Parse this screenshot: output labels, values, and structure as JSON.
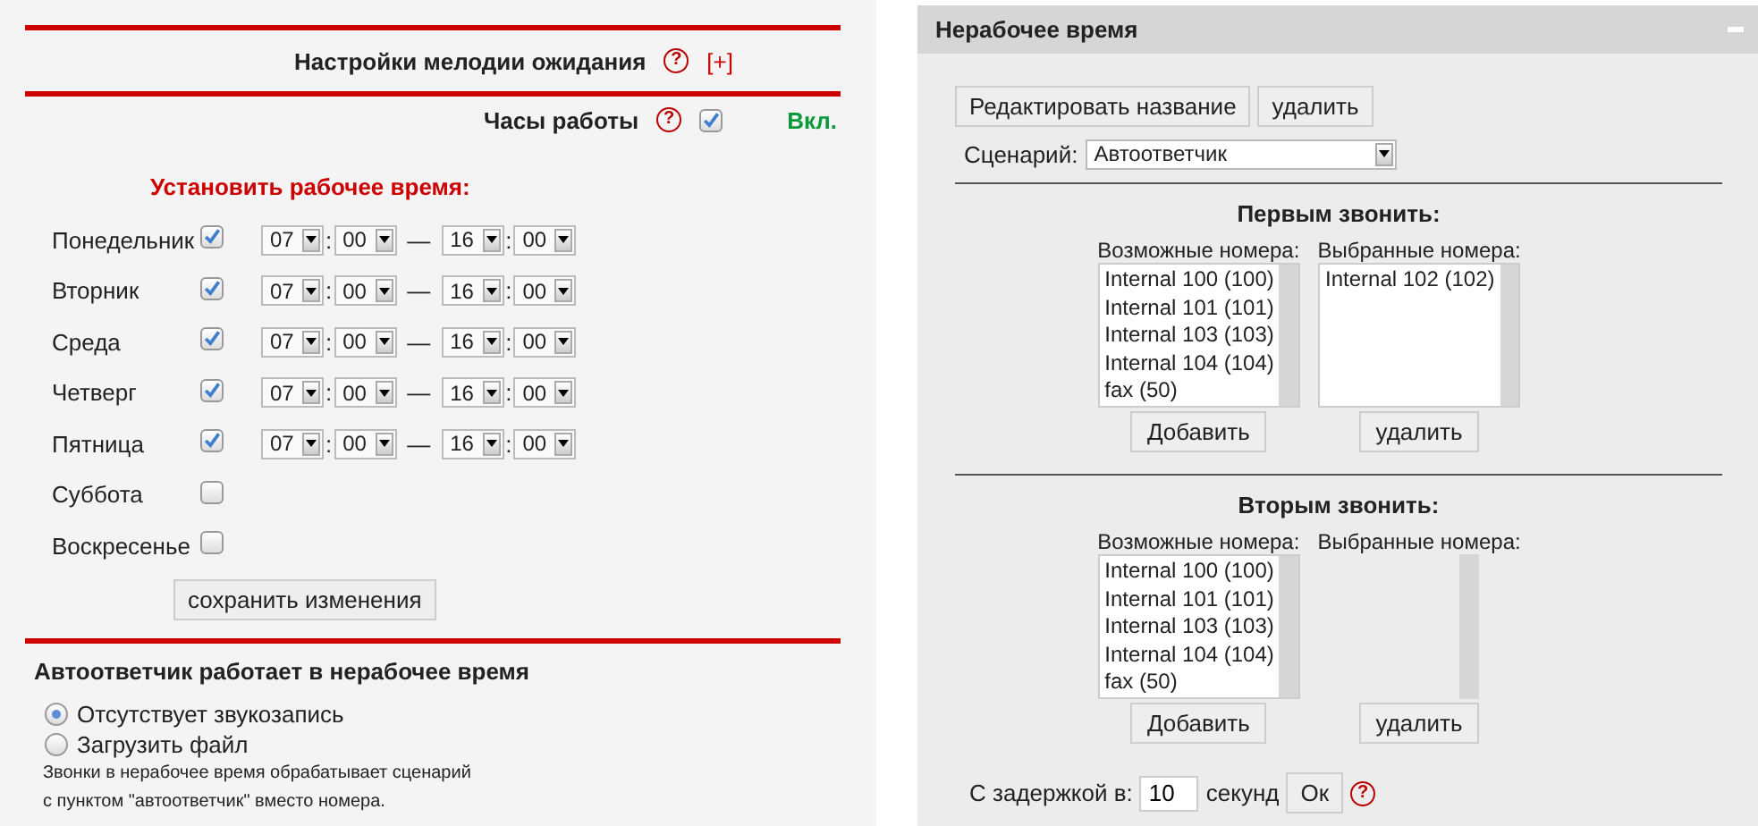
{
  "hold_music": {
    "title": "Настройки мелодии ожидания",
    "help": "?",
    "expand": "[+]"
  },
  "working_hours": {
    "label": "Часы работы",
    "help": "?",
    "checked": true,
    "status": "Вкл."
  },
  "schedule": {
    "title": "Установить рабочее время:",
    "days": [
      {
        "name": "Понедельник",
        "checked": true,
        "from_hour": "07",
        "sep1": ":",
        "from_minute": "00",
        "dash": "—",
        "to_hour": "16",
        "sep2": ":",
        "to_minute": "00"
      },
      {
        "name": "Вторник",
        "checked": true,
        "from_hour": "07",
        "sep1": ":",
        "from_minute": "00",
        "dash": "—",
        "to_hour": "16",
        "sep2": ":",
        "to_minute": "00"
      },
      {
        "name": "Среда",
        "checked": true,
        "from_hour": "07",
        "sep1": ":",
        "from_minute": "00",
        "dash": "—",
        "to_hour": "16",
        "sep2": ":",
        "to_minute": "00"
      },
      {
        "name": "Четверг",
        "checked": true,
        "from_hour": "07",
        "sep1": ":",
        "from_minute": "00",
        "dash": "—",
        "to_hour": "16",
        "sep2": ":",
        "to_minute": "00"
      },
      {
        "name": "Пятница",
        "checked": true,
        "from_hour": "07",
        "sep1": ":",
        "from_minute": "00",
        "dash": "—",
        "to_hour": "16",
        "sep2": ":",
        "to_minute": "00"
      },
      {
        "name": "Суббота",
        "checked": false
      },
      {
        "name": "Воскресенье",
        "checked": false
      }
    ],
    "save_button": "сохранить изменения"
  },
  "autoresponder": {
    "title": "Автоответчик работает в нерабочее время",
    "options": [
      {
        "label": "Отсутствует звукозапись",
        "selected": true
      },
      {
        "label": "Загрузить файл",
        "selected": false
      }
    ],
    "note": [
      "Звонки в нерабочее время обрабатывает сценарий",
      "с пунктом \"автоответчик\" вместо номера."
    ]
  },
  "panel": {
    "title": "Нерабочее время",
    "buttons": [
      "Редактировать название",
      "удалить"
    ],
    "scenario": {
      "label": "Сценарий:",
      "value": "Автоответчик"
    },
    "groups": [
      {
        "title": "Первым звонить:",
        "available_label": "Возможные номера:",
        "available": [
          "Internal 100 (100)",
          "Internal 101 (101)",
          "Internal 103 (103)",
          "Internal 104 (104)",
          "fax (50)"
        ],
        "selected_label": "Выбранные номера:",
        "selected": [
          "Internal 102 (102)"
        ],
        "add_button": "Добавить",
        "remove_button": "удалить"
      },
      {
        "title": "Вторым звонить:",
        "available_label": "Возможные номера:",
        "available": [
          "Internal 100 (100)",
          "Internal 101 (101)",
          "Internal 103 (103)",
          "Internal 104 (104)",
          "fax (50)"
        ],
        "selected_label": "Выбранные номера:",
        "add_button": "Добавить",
        "remove_button": "удалить"
      }
    ],
    "delay": {
      "label": "С задержкой в:",
      "value": "10",
      "unit": "секунд",
      "ok_button": "Ок",
      "help": "?"
    }
  }
}
